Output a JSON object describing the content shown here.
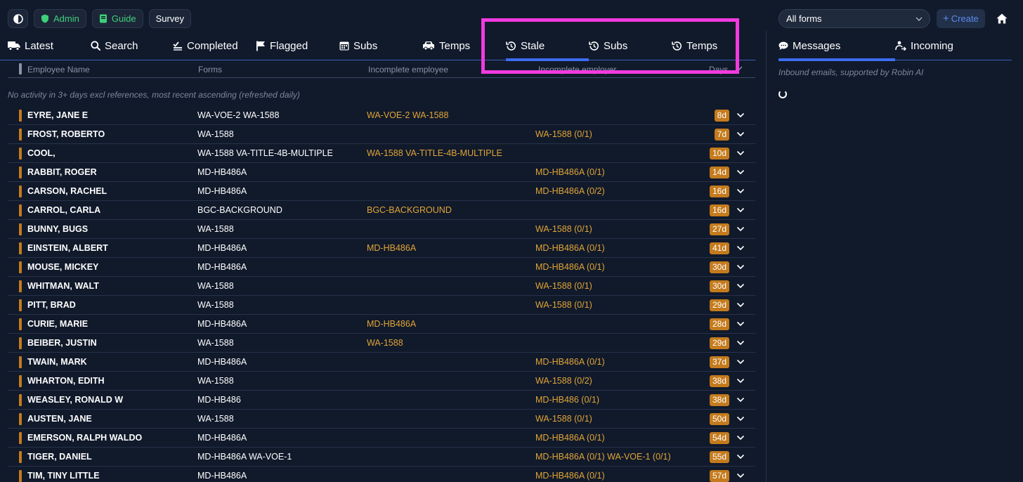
{
  "toolbar": {
    "theme_icon": "contrast-icon",
    "admin_label": "Admin",
    "guide_label": "Guide",
    "survey_label": "Survey"
  },
  "form_filter": {
    "selected": "All forms"
  },
  "create_label": "Create",
  "tabs": [
    {
      "label": "Latest",
      "icon": "truck-icon"
    },
    {
      "label": "Search",
      "icon": "search-icon"
    },
    {
      "label": "Completed",
      "icon": "checks-icon"
    },
    {
      "label": "Flagged",
      "icon": "flag-icon"
    },
    {
      "label": "Subs",
      "icon": "calendar-icon"
    },
    {
      "label": "Temps",
      "icon": "car-icon"
    },
    {
      "label": "Stale",
      "icon": "history-icon",
      "active": true
    },
    {
      "label": "Subs",
      "icon": "history-icon"
    },
    {
      "label": "Temps",
      "icon": "history-icon"
    }
  ],
  "columns": [
    "Employee Name",
    "Forms",
    "Incomplete employee",
    "Incomplete employer",
    "Days"
  ],
  "note": "No activity in 3+ days excl references, most recent ascending (refreshed daily)",
  "rows": [
    {
      "name": "EYRE, JANE E",
      "forms": "WA-VOE-2 WA-1588",
      "inc_emp": "WA-VOE-2 WA-1588",
      "inc_empr": "",
      "days": "8d"
    },
    {
      "name": "FROST, ROBERTO",
      "forms": "WA-1588",
      "inc_emp": "",
      "inc_empr": "WA-1588 (0/1)",
      "days": "7d"
    },
    {
      "name": "COOL,",
      "forms": "WA-1588 VA-TITLE-4B-MULTIPLE",
      "inc_emp": "WA-1588 VA-TITLE-4B-MULTIPLE",
      "inc_empr": "",
      "days": "10d"
    },
    {
      "name": "RABBIT, ROGER",
      "forms": "MD-HB486A",
      "inc_emp": "",
      "inc_empr": "MD-HB486A (0/1)",
      "days": "14d"
    },
    {
      "name": "CARSON, RACHEL",
      "forms": "MD-HB486A",
      "inc_emp": "",
      "inc_empr": "MD-HB486A (0/2)",
      "days": "16d"
    },
    {
      "name": "CARROL, CARLA",
      "forms": "BGC-BACKGROUND",
      "inc_emp": "BGC-BACKGROUND",
      "inc_empr": "",
      "days": "16d"
    },
    {
      "name": "BUNNY, BUGS",
      "forms": "WA-1588",
      "inc_emp": "",
      "inc_empr": "WA-1588 (0/1)",
      "days": "27d"
    },
    {
      "name": "EINSTEIN, ALBERT",
      "forms": "MD-HB486A",
      "inc_emp": "MD-HB486A",
      "inc_empr": "MD-HB486A (0/1)",
      "days": "41d"
    },
    {
      "name": "MOUSE, MICKEY",
      "forms": "MD-HB486A",
      "inc_emp": "",
      "inc_empr": "MD-HB486A (0/1)",
      "days": "30d"
    },
    {
      "name": "WHITMAN, WALT",
      "forms": "WA-1588",
      "inc_emp": "",
      "inc_empr": "WA-1588 (0/1)",
      "days": "30d"
    },
    {
      "name": "PITT, BRAD",
      "forms": "WA-1588",
      "inc_emp": "",
      "inc_empr": "WA-1588 (0/1)",
      "days": "29d"
    },
    {
      "name": "CURIE, MARIE",
      "forms": "MD-HB486A",
      "inc_emp": "MD-HB486A",
      "inc_empr": "",
      "days": "28d"
    },
    {
      "name": "BEIBER, JUSTIN",
      "forms": "WA-1588",
      "inc_emp": "WA-1588",
      "inc_empr": "",
      "days": "29d"
    },
    {
      "name": "TWAIN, MARK",
      "forms": "MD-HB486A",
      "inc_emp": "",
      "inc_empr": "MD-HB486A (0/1)",
      "days": "37d"
    },
    {
      "name": "WHARTON, EDITH",
      "forms": "WA-1588",
      "inc_emp": "",
      "inc_empr": "WA-1588 (0/2)",
      "days": "38d"
    },
    {
      "name": "WEASLEY, RONALD W",
      "forms": "MD-HB486",
      "inc_emp": "",
      "inc_empr": "MD-HB486 (0/1)",
      "days": "38d"
    },
    {
      "name": "AUSTEN, JANE",
      "forms": "WA-1588",
      "inc_emp": "",
      "inc_empr": "WA-1588 (0/1)",
      "days": "50d"
    },
    {
      "name": "EMERSON, RALPH WALDO",
      "forms": "MD-HB486A",
      "inc_emp": "",
      "inc_empr": "MD-HB486A (0/1)",
      "days": "54d"
    },
    {
      "name": "TIGER, DANIEL",
      "forms": "MD-HB486A WA-VOE-1",
      "inc_emp": "",
      "inc_empr": "MD-HB486A (0/1) WA-VOE-1 (0/1)",
      "days": "55d"
    },
    {
      "name": "TIM, TINY LITTLE",
      "forms": "MD-HB486A",
      "inc_emp": "",
      "inc_empr": "MD-HB486A (0/1)",
      "days": "57d"
    }
  ],
  "right_panel": {
    "tabs": [
      {
        "label": "Messages",
        "icon": "chat-icon",
        "active": true
      },
      {
        "label": "Incoming",
        "icon": "incoming-icon"
      }
    ],
    "subtitle": "Inbound emails, supported by Robin AI"
  },
  "colors": {
    "background": "#111a2b",
    "accent_blue": "#3b6cf0",
    "orange": "#c47b1d",
    "amber_text": "#e0a437",
    "highlight": "#f23ae0",
    "green": "#3fd07a"
  }
}
